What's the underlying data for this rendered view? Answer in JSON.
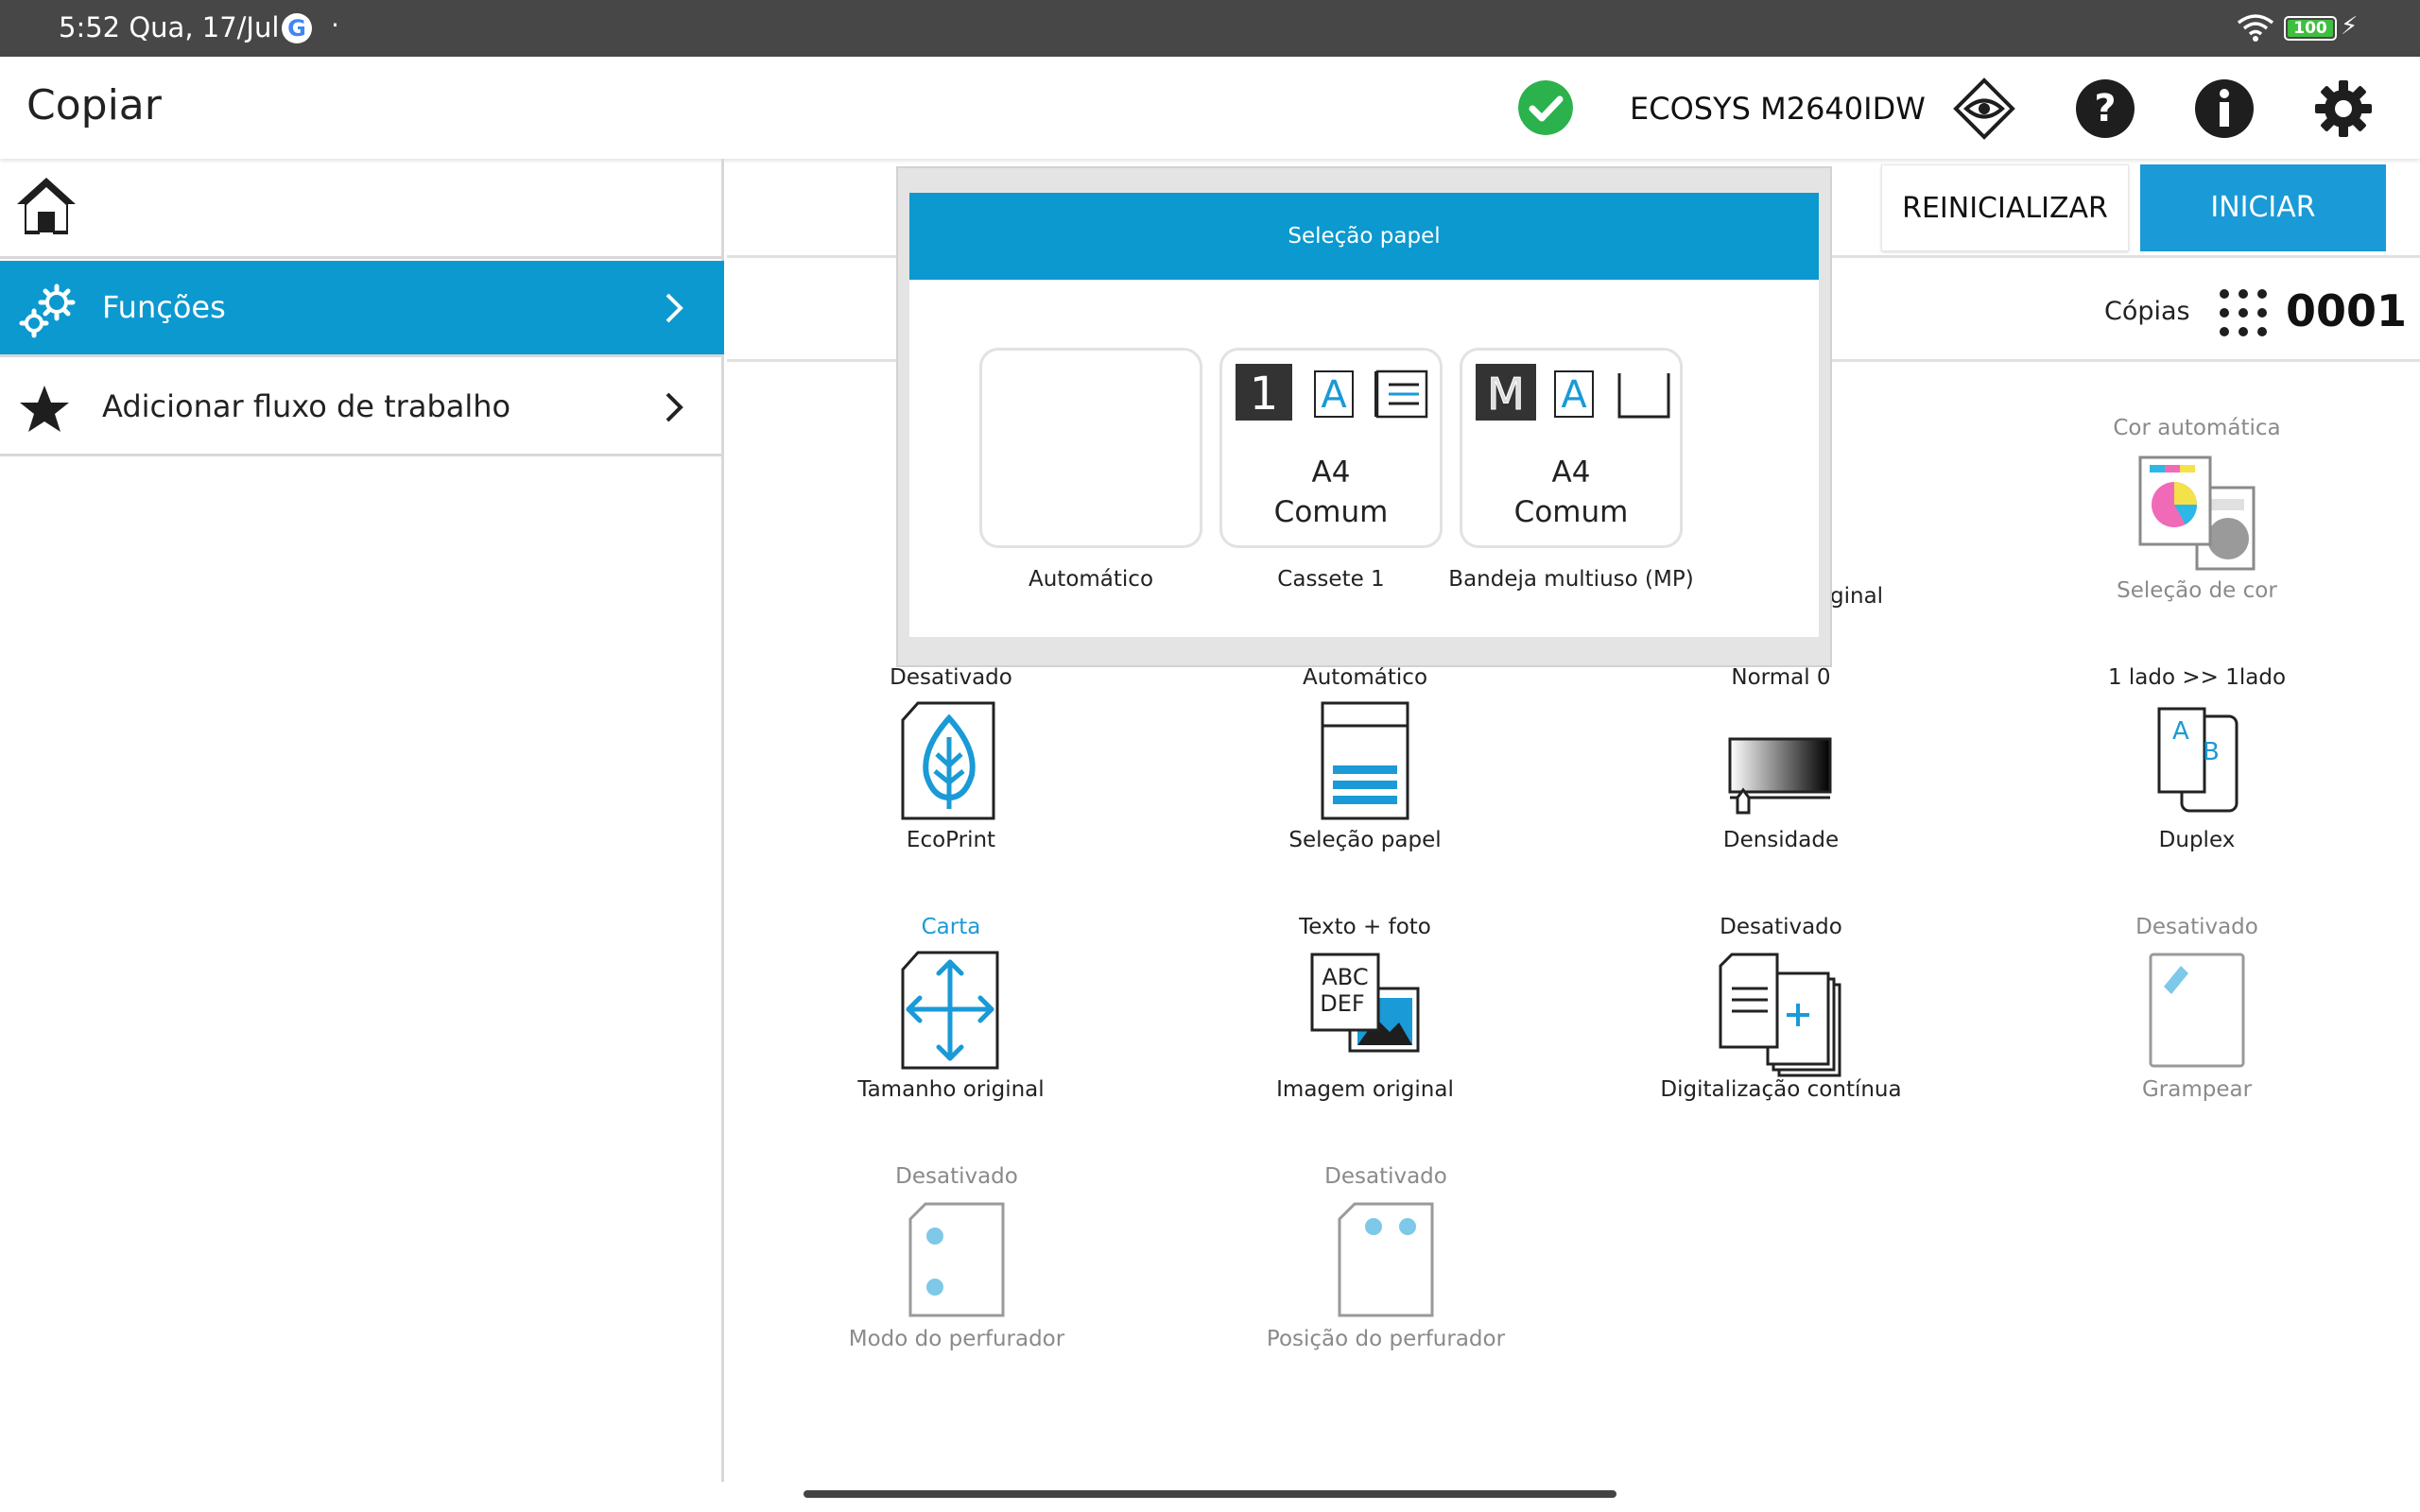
{
  "status_bar": {
    "time": "5:52 Qua, 17/Jul",
    "battery": "100"
  },
  "header": {
    "title": "Copiar",
    "device_name": "ECOSYS M2640IDW"
  },
  "sidebar": {
    "items": [
      {
        "label": "Funções"
      },
      {
        "label": "Adicionar fluxo de trabalho"
      }
    ]
  },
  "actions": {
    "reset_label": "REINICIALIZAR",
    "start_label": "INICIAR"
  },
  "copies": {
    "label": "Cópias",
    "value": "0001"
  },
  "functions": [
    {
      "status": "Cor automática",
      "name": "Seleção de cor"
    },
    {
      "status": "Desativado",
      "name": "EcoPrint"
    },
    {
      "status": "Automático",
      "name": "Seleção papel"
    },
    {
      "status": "Normal 0",
      "name": "Densidade"
    },
    {
      "status": "1 lado >> 1lado",
      "name": "Duplex"
    },
    {
      "status": "Carta",
      "name": "Tamanho original"
    },
    {
      "status": "Texto + foto",
      "name": "Imagem original"
    },
    {
      "status": "Desativado",
      "name": "Digitalização contínua"
    },
    {
      "status": "Desativado",
      "name": "Grampear"
    },
    {
      "status": "Desativado",
      "name": "Modo do perfurador"
    },
    {
      "status": "Desativado",
      "name": "Posição do perfurador"
    }
  ],
  "hidden_fragment": "ginal",
  "popup": {
    "title": "Seleção papel",
    "options": [
      {
        "label": "Automático",
        "size": "",
        "type": ""
      },
      {
        "label": "Cassete 1",
        "size": "A4",
        "type": "Comum",
        "badge": "1"
      },
      {
        "label": "Bandeja multiuso (MP)",
        "size": "A4",
        "type": "Comum",
        "badge": "M"
      }
    ]
  },
  "colors": {
    "accent": "#0b99cf",
    "button": "#1a9ad6",
    "ok": "#2bb24c"
  }
}
